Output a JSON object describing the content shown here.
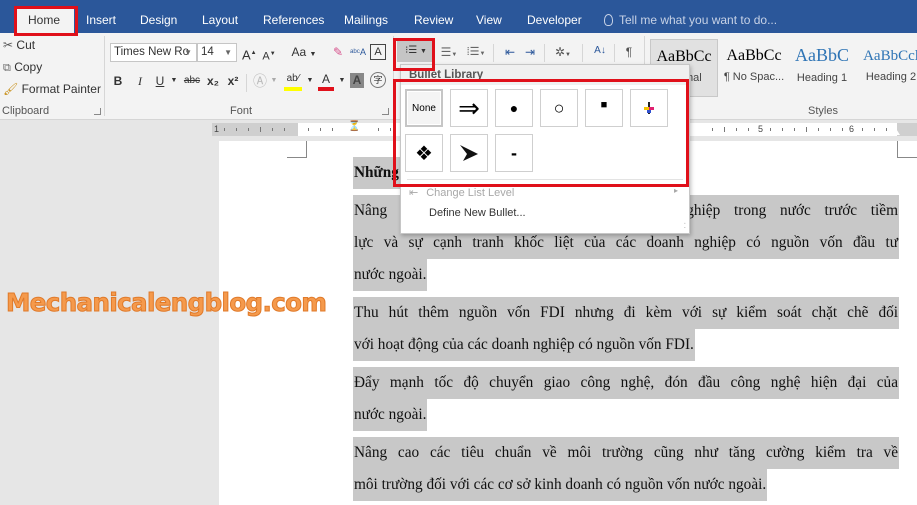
{
  "tabs": [
    {
      "label": "Home",
      "active": true
    },
    {
      "label": "Insert"
    },
    {
      "label": "Design"
    },
    {
      "label": "Layout"
    },
    {
      "label": "References"
    },
    {
      "label": "Mailings"
    },
    {
      "label": "Review"
    },
    {
      "label": "View"
    },
    {
      "label": "Developer"
    }
  ],
  "tell_me": "Tell me what you want to do...",
  "clipboard": {
    "cut": "Cut",
    "copy": "Copy",
    "format_painter": "Format Painter",
    "group_label": "Clipboard"
  },
  "font": {
    "font_name": "Times New Ro",
    "font_size": "14",
    "change_case": "Aa",
    "bold": "B",
    "italic": "I",
    "underline": "U",
    "strikethrough": "abc",
    "subscript": "x₂",
    "superscript": "x²",
    "group_label": "Font"
  },
  "styles": {
    "items": [
      {
        "sample": "AaBbCc",
        "name": "Normal"
      },
      {
        "sample": "AaBbCc",
        "name": "¶ No Spac..."
      },
      {
        "sample": "AaBbC",
        "name": "Heading 1"
      },
      {
        "sample": "AaBbCcl",
        "name": "Heading 2"
      }
    ],
    "group_label": "Styles"
  },
  "ruler": {
    "labels": [
      "1",
      "5",
      "6"
    ]
  },
  "bullet_library": {
    "title": "Bullet Library",
    "none_label": "None",
    "bullets": [
      "None",
      "⇒",
      "●",
      "○",
      "■",
      "✢",
      "❖",
      "➤",
      "-"
    ],
    "menu": {
      "change_list_level": "Change List Level",
      "define_new_bullet": "Define New Bullet..."
    }
  },
  "document": {
    "heading": "Những",
    "paragraphs": [
      {
        "lines": [
          "Nâng cao sức cạnh tranh của các doanh nghiệp trong nước trước tiềm",
          "lực và sự cạnh tranh khốc liệt của các doanh nghiệp có nguồn vốn đầu tư",
          "nước ngoài."
        ]
      },
      {
        "lines": [
          "Thu hút thêm nguồn vốn FDI nhưng đi kèm với sự kiểm soát chặt chẽ đối",
          "với hoạt động của các doanh nghiệp có nguồn vốn FDI."
        ]
      },
      {
        "lines": [
          "Đẩy mạnh tốc độ chuyển giao công nghệ, đón đầu công nghệ hiện đại của",
          "nước ngoài."
        ]
      },
      {
        "lines": [
          "Nâng cao các tiêu chuẩn về môi trường cũng như tăng cường kiểm tra về",
          "môi trường đối với các cơ sở kinh doanh có nguồn vốn nước ngoài."
        ]
      }
    ],
    "visible_fragments": {
      "p1_line1_right": "nghiệp trong nước trước tiềm",
      "p1_line1_left": "Nâng",
      "p1_line2": "lực và sự cạnh tranh khốc liệt của các doanh nghiệp có nguồn vốn đầu tư"
    }
  },
  "watermark": "Mechanicalengblog.com"
}
